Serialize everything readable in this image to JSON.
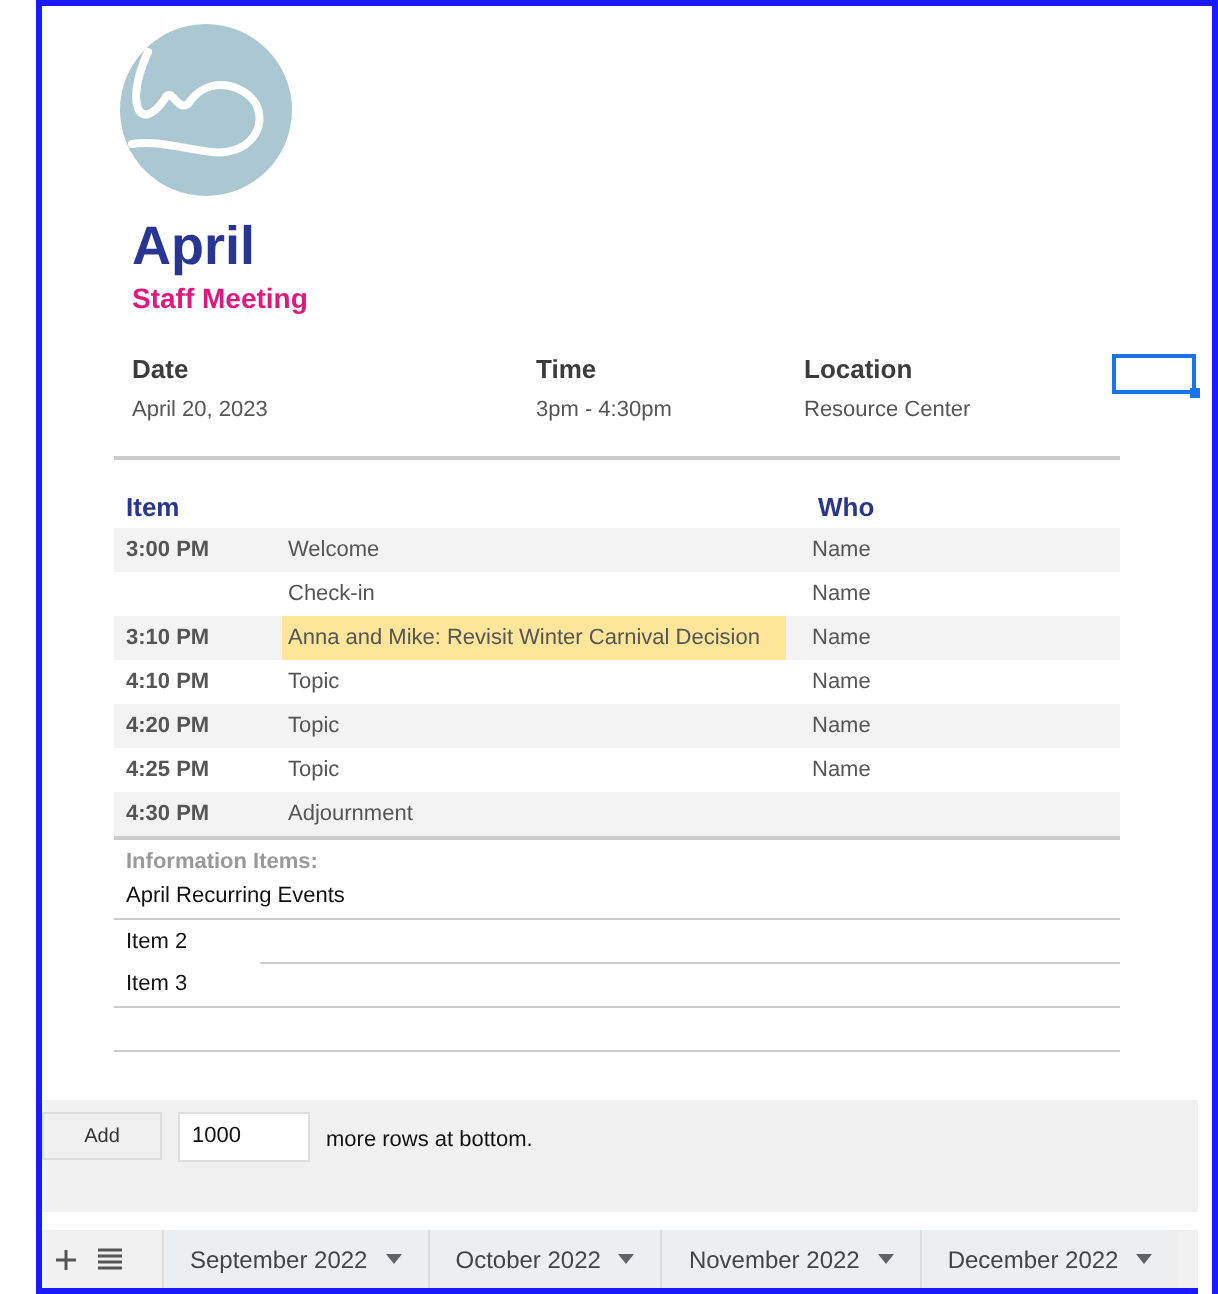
{
  "title": "April",
  "subtitle": "Staff Meeting",
  "details": [
    {
      "label": "Date",
      "value": "April 20, 2023"
    },
    {
      "label": "Time",
      "value": "3pm - 4:30pm"
    },
    {
      "label": "Location",
      "value": "Resource Center"
    }
  ],
  "agenda": {
    "columns": [
      "Item",
      "Who"
    ],
    "rows": [
      {
        "time": "3:00 PM",
        "item": "Welcome",
        "who": "Name",
        "highlighted": false
      },
      {
        "item": "Check-in",
        "who": "Name",
        "highlighted": false
      },
      {
        "time": "3:10 PM",
        "item": "Anna and Mike: Revisit Winter Carnival Decision",
        "who": "Name",
        "highlighted": true
      },
      {
        "time": "4:10 PM",
        "item": "Topic",
        "who": "Name",
        "highlighted": false
      },
      {
        "time": "4:20 PM",
        "item": "Topic",
        "who": "Name",
        "highlighted": false
      },
      {
        "time": "4:25 PM",
        "item": "Topic",
        "who": "Name",
        "highlighted": false
      },
      {
        "time": "4:30 PM",
        "item": "Adjournment",
        "highlighted": false
      }
    ]
  },
  "information": {
    "heading": "Information Items:",
    "items": [
      "April Recurring Events",
      "Item 2",
      "Item 3"
    ]
  },
  "add_rows": {
    "button": "Add",
    "value": "1000",
    "suffix": "more rows at bottom."
  },
  "sheet_tabs": [
    {
      "label": "September 2022",
      "selected": false
    },
    {
      "label": "October 2022",
      "selected": false
    },
    {
      "label": "November 2022",
      "selected": false
    },
    {
      "label": "December 2022",
      "selected": false
    }
  ]
}
